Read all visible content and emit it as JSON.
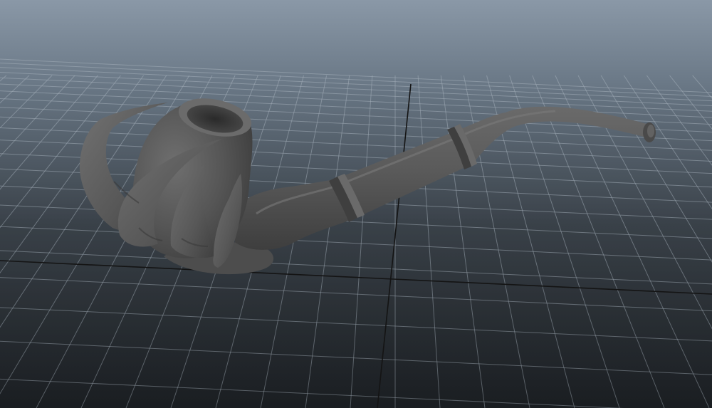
{
  "viewport": {
    "background_top": "#8795a4",
    "background_horizon": "#5f6d7b",
    "background_bottom": "#23272b",
    "grid_color": "#9aa6b2",
    "axis_color": "#111111",
    "model_color": "#5a5a5a"
  },
  "icons": {
    "model": "pipe-model-icon"
  }
}
